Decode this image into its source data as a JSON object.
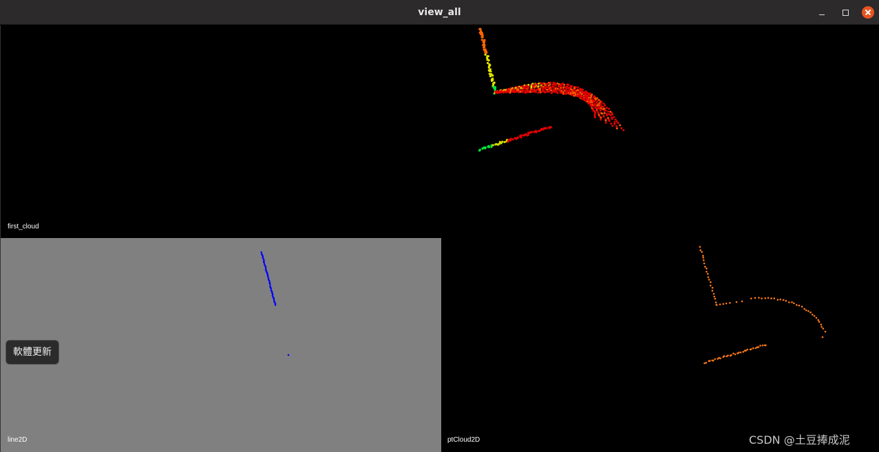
{
  "window": {
    "title": "view_all",
    "minimize_label": "",
    "maximize_label": "",
    "close_label": ""
  },
  "viewports": {
    "first_cloud": {
      "label": "first_cloud",
      "background": "#000000"
    },
    "line2d": {
      "label": "line2D",
      "background": "#808080"
    },
    "ptcloud2d": {
      "label": "ptCloud2D",
      "background": "#000000"
    }
  },
  "update_button": {
    "label": "軟體更新"
  },
  "watermark": {
    "text": "CSDN @土豆捧成泥"
  },
  "colors": {
    "line_color": "#0000ff",
    "ptcloud_color": "#ff7a1a",
    "close_button": "#e95420"
  }
}
